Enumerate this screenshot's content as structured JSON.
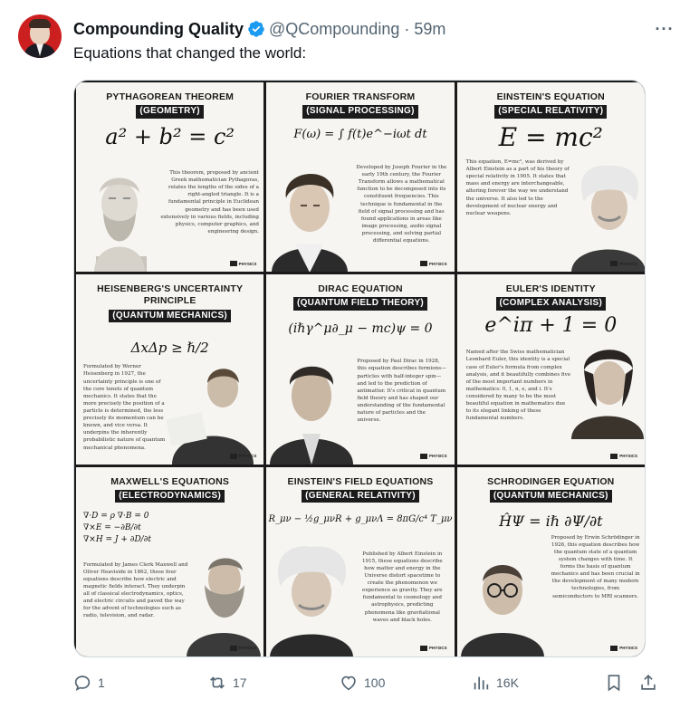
{
  "tweet": {
    "author_name": "Compounding Quality",
    "handle": "@QCompounding",
    "separator": "·",
    "time": "59m",
    "text": "Equations that changed the world:",
    "verified_color": "#1d9bf0"
  },
  "panels": [
    {
      "title": "PYTHAGOREAN THEOREM",
      "subtitle": "(GEOMETRY)",
      "equation": "a² + b² = c²",
      "desc": "This theorem, proposed by ancient Greek mathematician Pythagoras, relates the lengths of the sides of a right-angled triangle. It is a fundamental principle in Euclidean geometry and has been used extensively in various fields, including physics, computer graphics, and engineering design."
    },
    {
      "title": "FOURIER TRANSFORM",
      "subtitle": "(SIGNAL PROCESSING)",
      "equation": "F(ω) = ∫ f(t)e^−iωt dt",
      "desc": "Developed by Joseph Fourier in the early 19th century, the Fourier Transform allows a mathematical function to be decomposed into its constituent frequencies. This technique is fundamental in the field of signal processing and has found applications in areas like image processing, audio signal processing, and solving partial differential equations."
    },
    {
      "title": "EINSTEIN'S EQUATION",
      "subtitle": "(SPECIAL RELATIVITY)",
      "equation": "E = mc²",
      "desc": "This equation, E=mc², was derived by Albert Einstein as a part of his theory of special relativity in 1905. It states that mass and energy are interchangeable, altering forever the way we understand the universe. It also led to the development of nuclear energy and nuclear weapons."
    },
    {
      "title": "HEISENBERG'S UNCERTAINTY PRINCIPLE",
      "subtitle": "(QUANTUM MECHANICS)",
      "equation": "ΔxΔp ≥ ℏ/2",
      "desc": "Formulated by Werner Heisenberg in 1927, the uncertainty principle is one of the core tenets of quantum mechanics. It states that the more precisely the position of a particle is determined, the less precisely its momentum can be known, and vice versa. It underpins the inherently probabilistic nature of quantum mechanical phenomena."
    },
    {
      "title": "DIRAC EQUATION",
      "subtitle": "(QUANTUM FIELD THEORY)",
      "equation": "(iℏγ^μ∂_μ − mc)ψ = 0",
      "desc": "Proposed by Paul Dirac in 1928, this equation describes fermions—particles with half-integer spin—and led to the prediction of antimatter. It's critical in quantum field theory and has shaped our understanding of the fundamental nature of particles and the universe."
    },
    {
      "title": "EULER'S IDENTITY",
      "subtitle": "(COMPLEX ANALYSIS)",
      "equation": "e^iπ + 1 = 0",
      "desc": "Named after the Swiss mathematician Leonhard Euler, this identity is a special case of Euler's formula from complex analysis, and it beautifully combines five of the most important numbers in mathematics: 0, 1, π, e, and i. It's considered by many to be the most beautiful equation in mathematics due to its elegant linking of these fundamental numbers."
    },
    {
      "title": "MAXWELL'S EQUATIONS",
      "subtitle": "(ELECTRODYNAMICS)",
      "equation": "∇·D = ρ  ∇·B = 0  ∇×E = −∂B/∂t  ∇×H = J + ∂D/∂t",
      "desc": "Formulated by James Clerk Maxwell and Oliver Heaviside in 1862, these four equations describe how electric and magnetic fields interact. They underpin all of classical electrodynamics, optics, and electric circuits and paved the way for the advent of technologies such as radio, television, and radar."
    },
    {
      "title": "EINSTEIN'S FIELD EQUATIONS",
      "subtitle": "(GENERAL RELATIVITY)",
      "equation": "R_μν − ½g_μνR + g_μνΛ = 8πG/c⁴ T_μν",
      "desc": "Published by Albert Einstein in 1915, these equations describe how matter and energy in the Universe distort spacetime to create the phenomenon we experience as gravity. They are fundamental to cosmology and astrophysics, predicting phenomena like gravitational waves and black holes."
    },
    {
      "title": "SCHRODINGER EQUATION",
      "subtitle": "(QUANTUM MECHANICS)",
      "equation": "ĤΨ = iℏ ∂Ψ/∂t",
      "desc": "Proposed by Erwin Schrödinger in 1926, this equation describes how the quantum state of a quantum system changes with time. It forms the basis of quantum mechanics and has been crucial in the development of many modern technologies, from semiconductors to MRI scanners."
    }
  ],
  "logo_text": "PHYSICS",
  "actions": {
    "reply": "1",
    "repost": "17",
    "like": "100",
    "views": "16K"
  }
}
